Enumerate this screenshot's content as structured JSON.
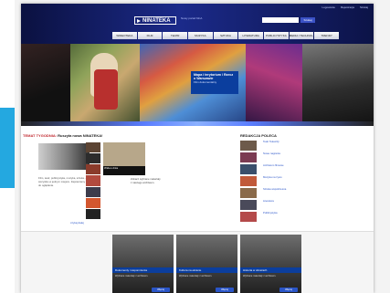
{
  "colors": {
    "accent": "#24a8e0",
    "header": "#1b2a8a",
    "nav_active": "#c0262d"
  },
  "header": {
    "top_links": [
      "Logowanie",
      "Rejestracja",
      "Szukaj"
    ],
    "logo": "NINATEKA",
    "tagline": "Nowy portal NInA",
    "search_placeholder": "",
    "search_button": "Szukaj",
    "nav": [
      "WIDEOTEKA",
      "FILM",
      "TEATR",
      "MUZYKA",
      "SZTUKA",
      "LITERATURA",
      "PUBLICYSTYKA",
      "MEDIA I TECHNOLOGIE",
      "TRENDY"
    ]
  },
  "banner": {
    "caption_title": "Mapa i terytorium / Rzecz o Warszawie",
    "caption_sub": "Film dokumentalny"
  },
  "main": {
    "section_label": "TEMAT TYGODNIA:",
    "section_title": "Ruszyła nowa NINATEKA!",
    "lead_text": "Film, teatr, publicystyka, muzyka, sztuka - wszystko w jednym miejscu. Zapraszamy do oglądania.",
    "more_link": "czytaj dalej",
    "feature_caption": "Wideo dnia",
    "feature_text": "Zobacz wybrane materiały z naszego archiwum."
  },
  "sidebar": {
    "title": "REDAKCJA POLECA",
    "items": [
      {
        "link": "Teatr Telewizji",
        "desc": ""
      },
      {
        "link": "Nowe nagrania",
        "desc": ""
      },
      {
        "link": "Archiwum filmowe",
        "desc": ""
      },
      {
        "link": "Muzyka na żywo",
        "desc": ""
      },
      {
        "link": "Sztuka współczesna",
        "desc": ""
      },
      {
        "link": "Literatura",
        "desc": ""
      },
      {
        "link": "Publicystyka",
        "desc": ""
      }
    ]
  },
  "promos": [
    {
      "title": "Dokumenty i wspomnienia",
      "text": "Wybrane materiały z archiwum.",
      "button": "Więcej"
    },
    {
      "title": "Kultura na ekranie",
      "text": "Wybrane materiały z archiwum.",
      "button": "Więcej"
    },
    {
      "title": "Historia w obrazach",
      "text": "Wybrane materiały z archiwum.",
      "button": "Więcej"
    }
  ]
}
